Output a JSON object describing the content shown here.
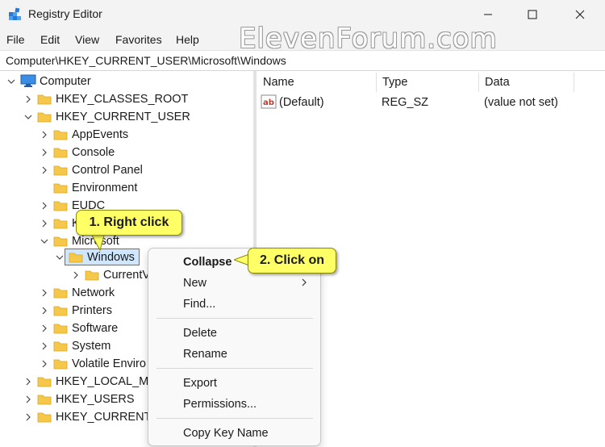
{
  "window": {
    "title": "Registry Editor"
  },
  "menu": [
    "File",
    "Edit",
    "View",
    "Favorites",
    "Help"
  ],
  "watermark": "ElevenForum.com",
  "address": "Computer\\HKEY_CURRENT_USER\\Microsoft\\Windows",
  "tree": {
    "computer": "Computer",
    "hkcr": "HKEY_CLASSES_ROOT",
    "hkcu": "HKEY_CURRENT_USER",
    "appevents": "AppEvents",
    "console": "Console",
    "control_panel": "Control Panel",
    "environment": "Environment",
    "eudc": "EUDC",
    "keyboard": "K",
    "microsoft": "Microsoft",
    "windows": "Windows",
    "currentversion": "CurrentV",
    "network": "Network",
    "printers": "Printers",
    "software": "Software",
    "system": "System",
    "volatile": "Volatile Enviro",
    "hklm": "HKEY_LOCAL_MA",
    "hku": "HKEY_USERS",
    "hkcc": "HKEY_CURRENT_("
  },
  "list": {
    "headers": {
      "name": "Name",
      "type": "Type",
      "data": "Data"
    },
    "rows": [
      {
        "name": "(Default)",
        "type": "REG_SZ",
        "data": "(value not set)"
      }
    ]
  },
  "context_menu": {
    "collapse": "Collapse",
    "new": "New",
    "find": "Find...",
    "delete": "Delete",
    "rename": "Rename",
    "export": "Export",
    "permissions": "Permissions...",
    "copy_key_name": "Copy Key Name"
  },
  "callouts": {
    "step1": "1. Right click",
    "step2": "2. Click on"
  },
  "colors": {
    "folder": "#f5c84c",
    "callout": "#ffff66",
    "selection": "#cfe6ff"
  }
}
